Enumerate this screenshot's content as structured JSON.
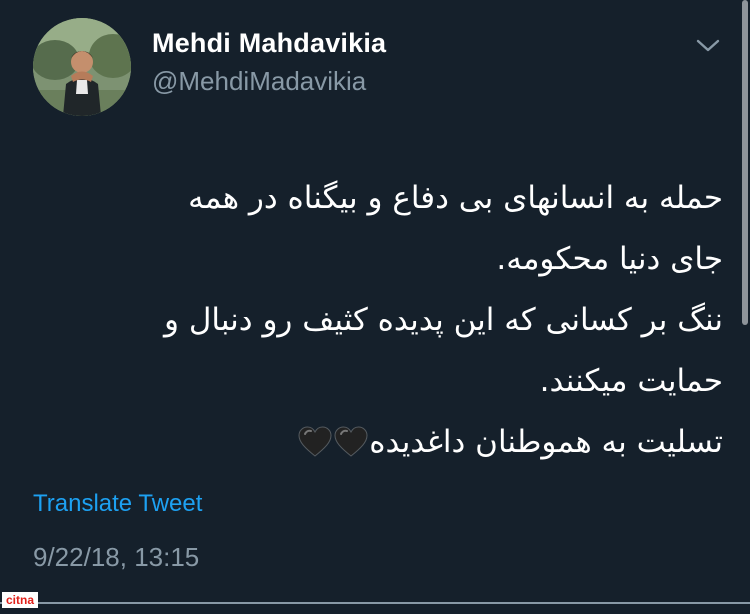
{
  "account": {
    "display_name": "Mehdi Mahdavikia",
    "handle": "@MehdiMadavikia"
  },
  "tweet": {
    "lines": [
      "حمله به انسانهای بی دفاع و بیگناه در همه",
      "جای دنیا محکومه.",
      "ننگ بر کسانی که این پدیده کثیف رو دنبال و",
      "حمایت میکنند.",
      "تسلیت به هموطنان داغدیده"
    ],
    "emoji": [
      "black-heart",
      "black-heart"
    ],
    "translate_label": "Translate Tweet",
    "timestamp": "9/22/18, 13:15"
  },
  "watermark": {
    "text": "citna"
  },
  "colors": {
    "background": "#15202b",
    "primary_text": "#ffffff",
    "secondary_text": "#8899a6",
    "link": "#1da1f2"
  },
  "icons": {
    "menu": "chevron-down-icon",
    "emoji": "black-heart-icon"
  }
}
